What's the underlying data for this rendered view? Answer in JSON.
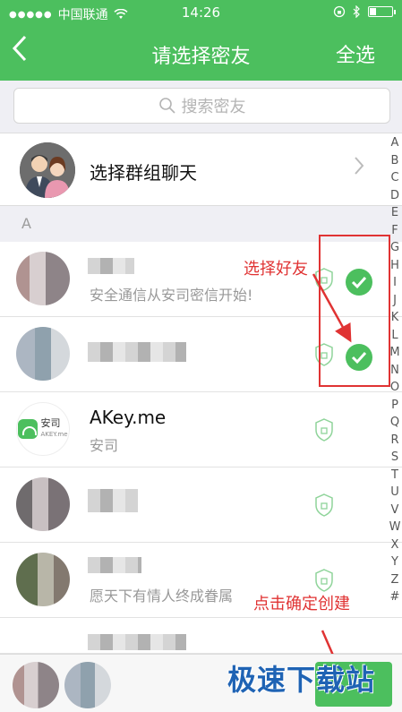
{
  "status_bar": {
    "signal": "●●●●●",
    "carrier": "中国联通",
    "time": "14:26"
  },
  "nav": {
    "back_icon": "chevron-left",
    "title": "请选择密友",
    "select_all": "全选"
  },
  "search": {
    "placeholder": "搜索密友"
  },
  "group_chat": {
    "label": "选择群组聊天"
  },
  "section_header": "A",
  "contacts": [
    {
      "name": "",
      "sub": "安全通信从安司密信开始!",
      "selected": true
    },
    {
      "name": "",
      "sub": "",
      "selected": true
    },
    {
      "name": "AKey.me",
      "sub": "安司",
      "selected": false
    },
    {
      "name": "",
      "sub": "",
      "selected": false
    },
    {
      "name": "",
      "sub": "愿天下有情人终成眷属",
      "selected": false
    }
  ],
  "akey_logo": {
    "line1": "安司",
    "line2": "AKEY.me"
  },
  "index_letters": [
    "A",
    "B",
    "C",
    "D",
    "E",
    "F",
    "G",
    "H",
    "I",
    "J",
    "K",
    "L",
    "M",
    "N",
    "O",
    "P",
    "Q",
    "R",
    "S",
    "T",
    "U",
    "V",
    "W",
    "X",
    "Y",
    "Z",
    "#"
  ],
  "annotations": {
    "select_friends": "选择好友",
    "confirm_create": "点击确定创建"
  },
  "watermark": "极速下载站",
  "colors": {
    "accent": "#4cbf5e",
    "annotation": "#e03333",
    "watermark": "#1f63b4"
  }
}
